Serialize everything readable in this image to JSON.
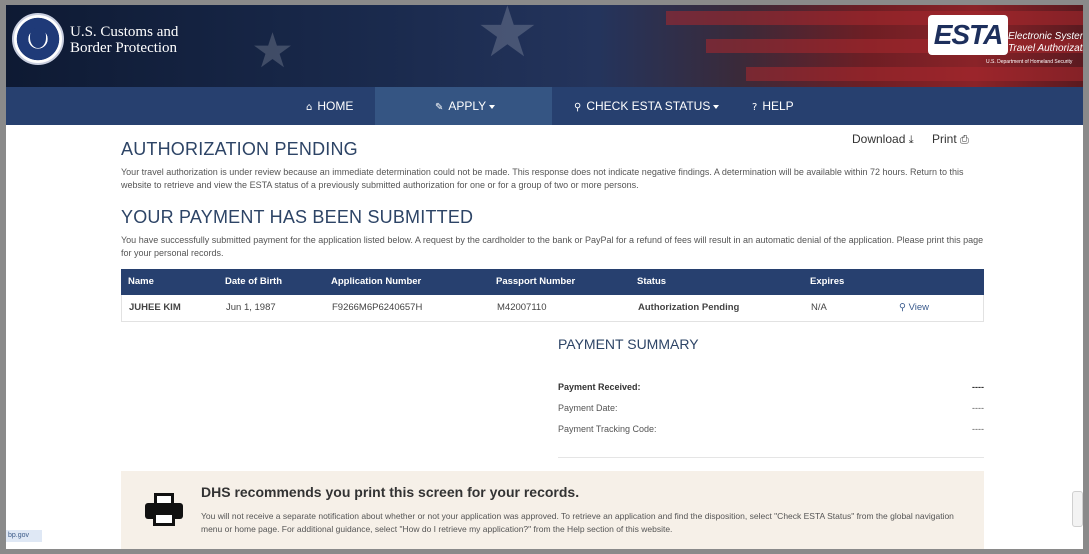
{
  "header": {
    "agency_line1": "U.S. Customs and",
    "agency_line2": "Border Protection",
    "esta_logo_text": "ESTA",
    "esta_tagline1": "Electronic System",
    "esta_tagline2": "Travel Authorization",
    "esta_dept": "U.S. Department of Homeland Security"
  },
  "nav": {
    "home": "HOME",
    "apply": "APPLY",
    "check_status": "CHECK ESTA STATUS",
    "help": "HELP",
    "active": "apply"
  },
  "actions": {
    "download": "Download",
    "print": "Print"
  },
  "authorization": {
    "title": "AUTHORIZATION PENDING",
    "text": "Your travel authorization is under review because an immediate determination could not be made. This response does not indicate negative findings. A determination will be available within 72 hours. Return to this website to retrieve and view the ESTA status of a previously submitted authorization for one or for a group of two or more persons."
  },
  "payment_submitted": {
    "title": "YOUR PAYMENT HAS BEEN SUBMITTED",
    "text": "You have successfully submitted payment for the application listed below. A request by the cardholder to the bank or PayPal for a refund of fees will result in an automatic denial of the application. Please print this page for your personal records."
  },
  "table": {
    "headers": [
      "Name",
      "Date of Birth",
      "Application Number",
      "Passport Number",
      "Status",
      "Expires"
    ],
    "rows": [
      {
        "name": "JUHEE KIM",
        "dob": "Jun 1, 1987",
        "application_number": "F9266M6P6240657H",
        "passport_number": "M42007110",
        "status": "Authorization Pending",
        "expires": "N/A",
        "action": "View"
      }
    ]
  },
  "payment_summary": {
    "title": "PAYMENT SUMMARY",
    "rows": [
      {
        "label": "Payment Received:",
        "value": "----"
      },
      {
        "label": "Payment Date:",
        "value": "----"
      },
      {
        "label": "Payment Tracking Code:",
        "value": "----"
      }
    ]
  },
  "notice": {
    "title": "DHS recommends you print this screen for your records.",
    "text": "You will not receive a separate notification about whether or not your application was approved. To retrieve an application and find the disposition, select \"Check ESTA Status\" from the global navigation menu or home page. For additional guidance, select \"How do I retrieve my application?\" from the Help section of this website."
  },
  "footer": {
    "corner_link": "bp.gov"
  },
  "colors": {
    "nav_bg": "#27406f",
    "nav_active": "#355583",
    "heading": "#2d4466",
    "notice_bg": "#f6f0e8"
  },
  "icons": [
    "home-icon",
    "pencil-icon",
    "search-icon",
    "help-icon",
    "download-icon",
    "print-icon",
    "printer-icon"
  ]
}
